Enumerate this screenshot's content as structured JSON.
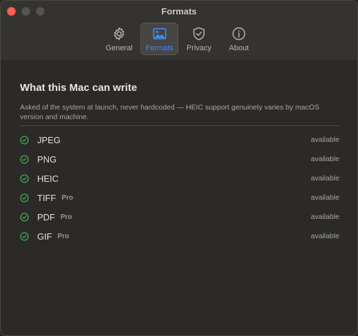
{
  "window": {
    "title": "Formats"
  },
  "toolbar": {
    "tabs": [
      {
        "label": "General",
        "icon": "gear-icon"
      },
      {
        "label": "Formats",
        "icon": "photo-icon",
        "selected": true
      },
      {
        "label": "Privacy",
        "icon": "shield-check-icon"
      },
      {
        "label": "About",
        "icon": "info-circle-icon"
      }
    ]
  },
  "main": {
    "heading": "What this Mac can write",
    "description": "Asked of the system at launch, never hardcoded — HEIC support genuinely varies by macOS version and machine.",
    "formats": [
      {
        "name": "JPEG",
        "badge": "",
        "status": "available"
      },
      {
        "name": "PNG",
        "badge": "",
        "status": "available"
      },
      {
        "name": "HEIC",
        "badge": "",
        "status": "available"
      },
      {
        "name": "TIFF",
        "badge": "Pro",
        "status": "available"
      },
      {
        "name": "PDF",
        "badge": "Pro",
        "status": "available"
      },
      {
        "name": "GIF",
        "badge": "Pro",
        "status": "available"
      }
    ]
  },
  "colors": {
    "accent": "#3f8cff",
    "check": "#3fbf5a",
    "close": "#fe5f57"
  }
}
